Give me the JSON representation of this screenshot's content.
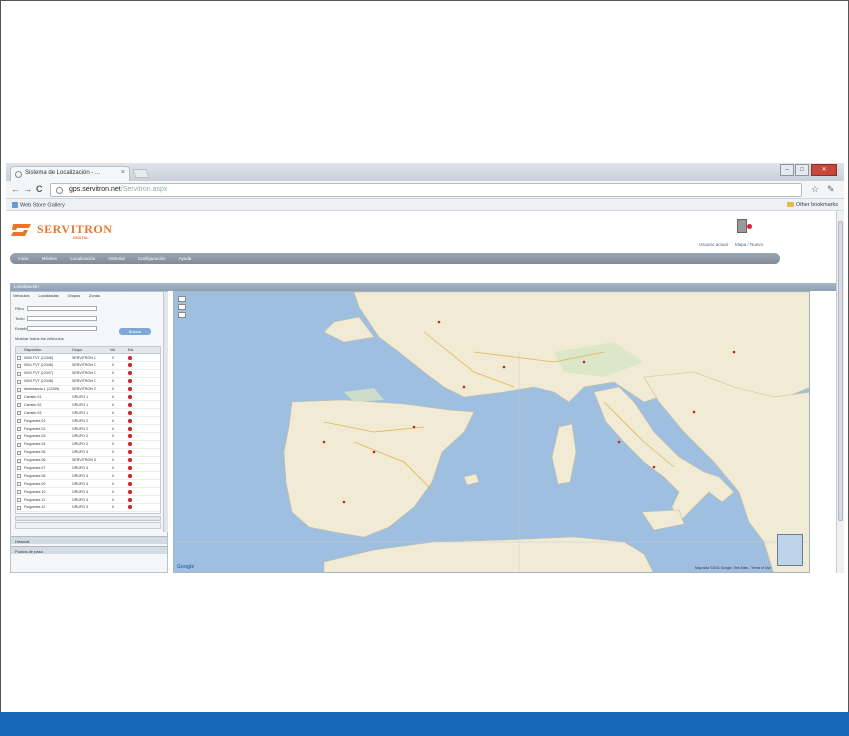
{
  "browser": {
    "tab_title": "Sistema de Localización - ...",
    "tab_close": "×",
    "url_domain": "gps.servitron.net",
    "url_path": "/Servitron.aspx",
    "bookmarks_left": "Web Store Gallery",
    "bookmarks_right": "Other bookmarks",
    "win_min": "–",
    "win_max": "□",
    "win_close": "✕",
    "back_glyph": "←",
    "forward_glyph": "→",
    "reload_glyph": "C",
    "star_glyph": "☆",
    "wrench_glyph": "✎"
  },
  "header": {
    "logo_text": "SERVITRON",
    "logo_sub": "DIGITAL",
    "user_link_1": "Usuario actual",
    "user_link_2": "Mapa / Nuevo"
  },
  "menu": [
    "Inicio",
    "Móviles",
    "Localización",
    "Historial",
    "Configuración",
    "Ayuda"
  ],
  "panel": {
    "title": "Localización",
    "tabs": [
      "Vehículos",
      "Localizadas",
      "Grupos",
      "Zonas"
    ],
    "filter_labels": [
      "Filtro",
      "Texto",
      "Estado"
    ],
    "search_button": "Buscar",
    "show_all": "Mostrar todos los vehículos",
    "columns": [
      "Dispositivo",
      "Grupo",
      "Vel.",
      "Est."
    ],
    "section_1": "Historial",
    "section_2": "Puntos de paso"
  },
  "vehicles": [
    {
      "name": "0000 FVT (12345)",
      "group": "SERVITRON 1",
      "speed": "0"
    },
    {
      "name": "0001 FVT (12346)",
      "group": "SERVITRON 1",
      "speed": "0"
    },
    {
      "name": "0002 FVT (12347)",
      "group": "SERVITRON 1",
      "speed": "0"
    },
    {
      "name": "0003 FVT (12348)",
      "group": "SERVITRON 1",
      "speed": "0"
    },
    {
      "name": "Ambulancia 1 (12349)",
      "group": "SERVITRON 2",
      "speed": "0"
    },
    {
      "name": "Camión 01",
      "group": "GRUPO 1",
      "speed": "0"
    },
    {
      "name": "Camión 02",
      "group": "GRUPO 1",
      "speed": "0"
    },
    {
      "name": "Camión 03",
      "group": "GRUPO 1",
      "speed": "0"
    },
    {
      "name": "Furgoneta 01",
      "group": "GRUPO 2",
      "speed": "0"
    },
    {
      "name": "Furgoneta 02",
      "group": "GRUPO 2",
      "speed": "0"
    },
    {
      "name": "Furgoneta 03",
      "group": "GRUPO 2",
      "speed": "0"
    },
    {
      "name": "Furgoneta 04",
      "group": "GRUPO 2",
      "speed": "0"
    },
    {
      "name": "Furgoneta 05",
      "group": "GRUPO 3",
      "speed": "0"
    },
    {
      "name": "Furgoneta 06",
      "group": "SERVITRON 3",
      "speed": "0"
    },
    {
      "name": "Furgoneta 07",
      "group": "GRUPO 3",
      "speed": "0"
    },
    {
      "name": "Furgoneta 08",
      "group": "GRUPO 3",
      "speed": "0"
    },
    {
      "name": "Furgoneta 09",
      "group": "GRUPO 3",
      "speed": "0"
    },
    {
      "name": "Furgoneta 10",
      "group": "GRUPO 3",
      "speed": "0"
    },
    {
      "name": "Furgoneta 11",
      "group": "GRUPO 3",
      "speed": "0"
    },
    {
      "name": "Furgoneta 12",
      "group": "GRUPO 3",
      "speed": "0"
    }
  ],
  "map": {
    "provider": "Google",
    "credit": "Map data ©2011 Google, Tele Atlas - Terms of Use",
    "sea_color": "#9fbfe0",
    "land_color": "#f1ebd6"
  },
  "icons": [
    "page-icon",
    "star-icon",
    "wrench-icon",
    "folder-icon",
    "exit-icon",
    "zoom-in-icon",
    "zoom-out-icon"
  ]
}
